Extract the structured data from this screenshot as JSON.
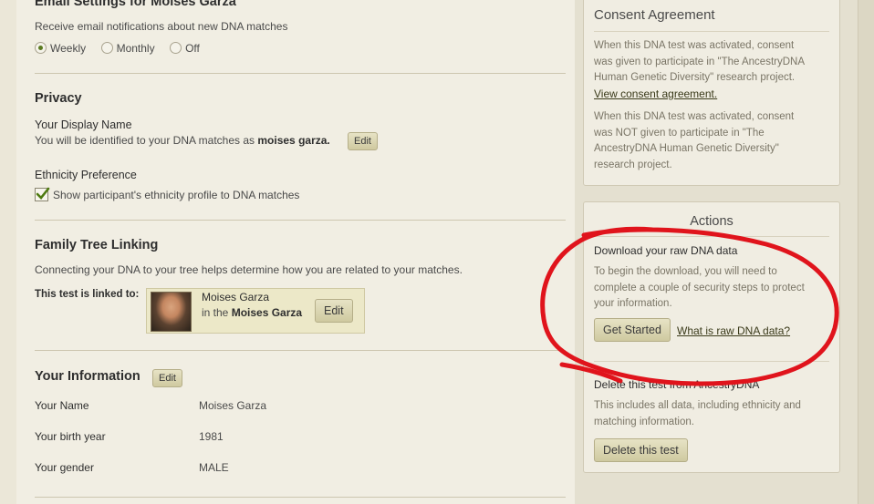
{
  "email": {
    "title": "Email Settings for Moises Garza",
    "desc": "Receive email notifications about new DNA matches",
    "options": [
      "Weekly",
      "Monthly",
      "Off"
    ],
    "selected": "Weekly"
  },
  "privacy": {
    "title": "Privacy",
    "display_name_label": "Your Display Name",
    "display_name_text": "You will be identified to your DNA matches as",
    "display_name_value": "moises garza.",
    "edit_label": "Edit",
    "ethnicity_label": "Ethnicity Preference",
    "ethnicity_checkbox": "Show participant's ethnicity profile to DNA matches",
    "ethnicity_checked": true
  },
  "tree": {
    "title": "Family Tree Linking",
    "desc": "Connecting your DNA to your tree helps determine how you are related to your matches.",
    "linked_label": "This test is linked to:",
    "person_name": "Moises Garza",
    "in_the": "in the",
    "tree_name": "Moises Garza",
    "edit_label": "Edit"
  },
  "info": {
    "title": "Your Information",
    "edit_label": "Edit",
    "fields": [
      {
        "label": "Your Name",
        "value": "Moises Garza"
      },
      {
        "label": "Your birth year",
        "value": "1981"
      },
      {
        "label": "Your gender",
        "value": "MALE"
      }
    ]
  },
  "consent": {
    "title": "Consent Agreement",
    "p1": [
      "When this DNA test was activated, consent",
      "was given to participate in \"The AncestryDNA",
      "Human Genetic Diversity\" research project."
    ],
    "link": "View consent agreement.",
    "p2": [
      "When this DNA test was activated, consent",
      "was NOT given to participate in \"The",
      "AncestryDNA Human Genetic Diversity\"",
      "research project."
    ]
  },
  "actions": {
    "title": "Actions",
    "download_title": "Download your raw DNA data",
    "download_desc": [
      "To begin the download, you will need to",
      "complete a couple of security steps to protect",
      "your information."
    ],
    "get_started": "Get Started",
    "raw_link": "What is raw DNA data?",
    "delete_title": "Delete this test from AncestryDNA",
    "delete_desc": [
      "This includes all data, including ethnicity and",
      "matching information."
    ],
    "delete_button": "Delete this test"
  },
  "colors": {
    "annotation": "#e0141c",
    "button": "#d9d4b0"
  }
}
